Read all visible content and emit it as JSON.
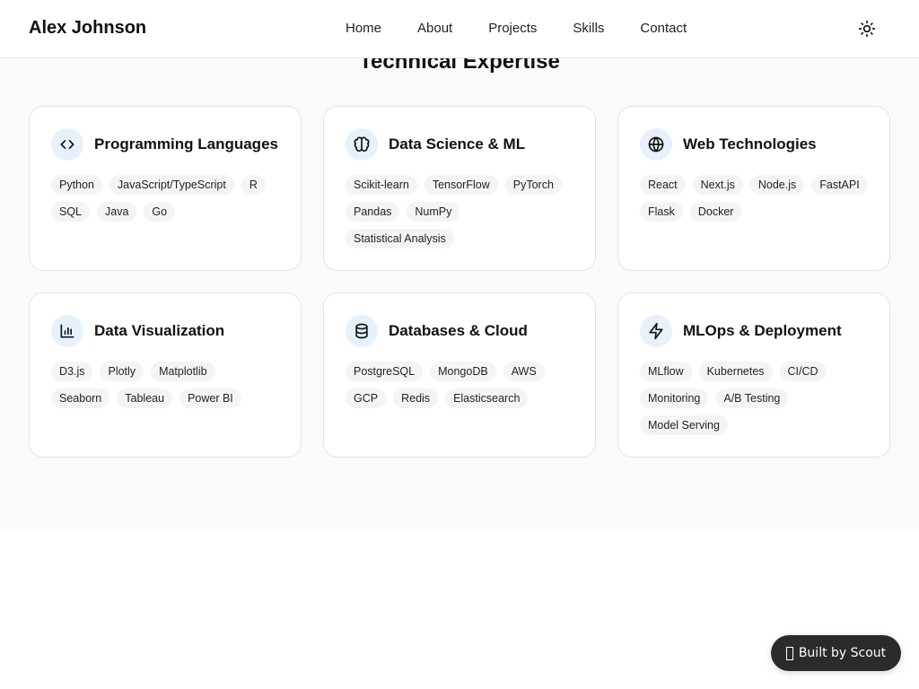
{
  "header": {
    "brand": "Alex Johnson",
    "nav": [
      "Home",
      "About",
      "Projects",
      "Skills",
      "Contact"
    ],
    "theme_icon": "sun-icon"
  },
  "section": {
    "title": "Technical Expertise"
  },
  "cards": [
    {
      "title": "Programming Languages",
      "icon": "code-icon",
      "skills": [
        "Python",
        "JavaScript/TypeScript",
        "R",
        "SQL",
        "Java",
        "Go"
      ]
    },
    {
      "title": "Data Science & ML",
      "icon": "brain-icon",
      "skills": [
        "Scikit-learn",
        "TensorFlow",
        "PyTorch",
        "Pandas",
        "NumPy",
        "Statistical Analysis"
      ]
    },
    {
      "title": "Web Technologies",
      "icon": "globe-icon",
      "skills": [
        "React",
        "Next.js",
        "Node.js",
        "FastAPI",
        "Flask",
        "Docker"
      ]
    },
    {
      "title": "Data Visualization",
      "icon": "bar-chart-icon",
      "skills": [
        "D3.js",
        "Plotly",
        "Matplotlib",
        "Seaborn",
        "Tableau",
        "Power BI"
      ]
    },
    {
      "title": "Databases & Cloud",
      "icon": "database-icon",
      "skills": [
        "PostgreSQL",
        "MongoDB",
        "AWS",
        "GCP",
        "Redis",
        "Elasticsearch"
      ]
    },
    {
      "title": "MLOps & Deployment",
      "icon": "zap-icon",
      "skills": [
        "MLflow",
        "Kubernetes",
        "CI/CD",
        "Monitoring",
        "A/B Testing",
        "Model Serving"
      ]
    }
  ],
  "badge": {
    "label": "Built by Scout"
  }
}
